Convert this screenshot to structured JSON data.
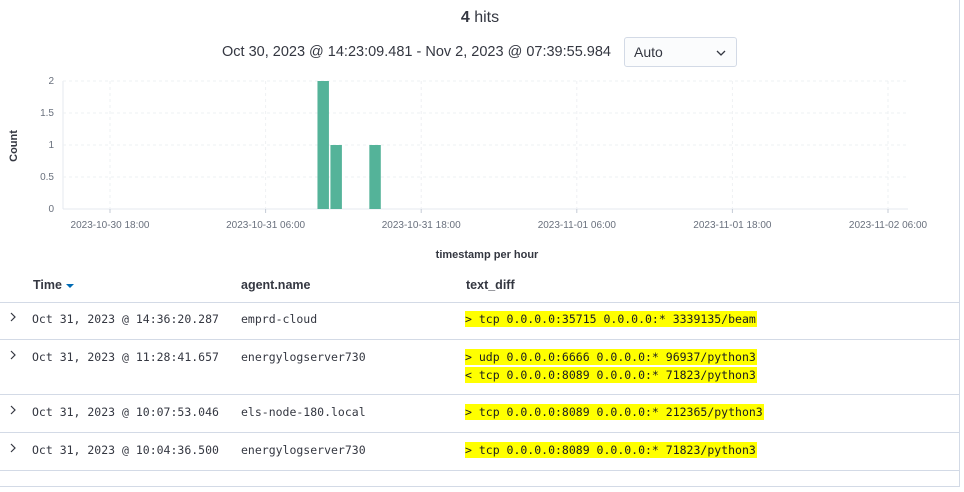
{
  "summary": {
    "count": "4",
    "label": "hits"
  },
  "time_range": {
    "text": "Oct 30, 2023 @ 14:23:09.481 - Nov 2, 2023 @ 07:39:55.984"
  },
  "interval_select": {
    "value": "Auto"
  },
  "chart_data": {
    "type": "bar",
    "title": "",
    "xlabel": "timestamp per hour",
    "ylabel": "Count",
    "ylim": [
      0,
      2
    ],
    "yticks": [
      "0",
      "0.5",
      "1",
      "1.5",
      "2"
    ],
    "xticks": [
      "2023-10-30 18:00",
      "2023-10-31 06:00",
      "2023-10-31 18:00",
      "2023-11-01 06:00",
      "2023-11-01 18:00",
      "2023-11-02 06:00"
    ],
    "series": [
      {
        "values": [
          {
            "x": "2023-10-31 10:00",
            "y": 2
          },
          {
            "x": "2023-10-31 11:00",
            "y": 1
          },
          {
            "x": "2023-10-31 14:00",
            "y": 1
          }
        ]
      }
    ],
    "bar_color": "#54b399",
    "grid": true
  },
  "table": {
    "columns": {
      "time": "Time",
      "agent": "agent.name",
      "diff": "text_diff"
    },
    "rows": [
      {
        "time": "Oct 31, 2023 @ 14:36:20.287",
        "agent": "emprd-cloud",
        "diff": [
          "> tcp 0.0.0.0:35715 0.0.0.0:* 3339135/beam"
        ]
      },
      {
        "time": "Oct 31, 2023 @ 11:28:41.657",
        "agent": "energylogserver730",
        "diff": [
          "> udp 0.0.0.0:6666 0.0.0.0:* 96937/python3",
          "< tcp 0.0.0.0:8089 0.0.0.0:* 71823/python3"
        ]
      },
      {
        "time": "Oct 31, 2023 @ 10:07:53.046",
        "agent": "els-node-180.local",
        "diff": [
          "> tcp 0.0.0.0:8089 0.0.0.0:* 212365/python3"
        ]
      },
      {
        "time": "Oct 31, 2023 @ 10:04:36.500",
        "agent": "energylogserver730",
        "diff": [
          "> tcp 0.0.0.0:8089 0.0.0.0:* 71823/python3"
        ]
      }
    ]
  },
  "highlight_color": "#ffff00"
}
